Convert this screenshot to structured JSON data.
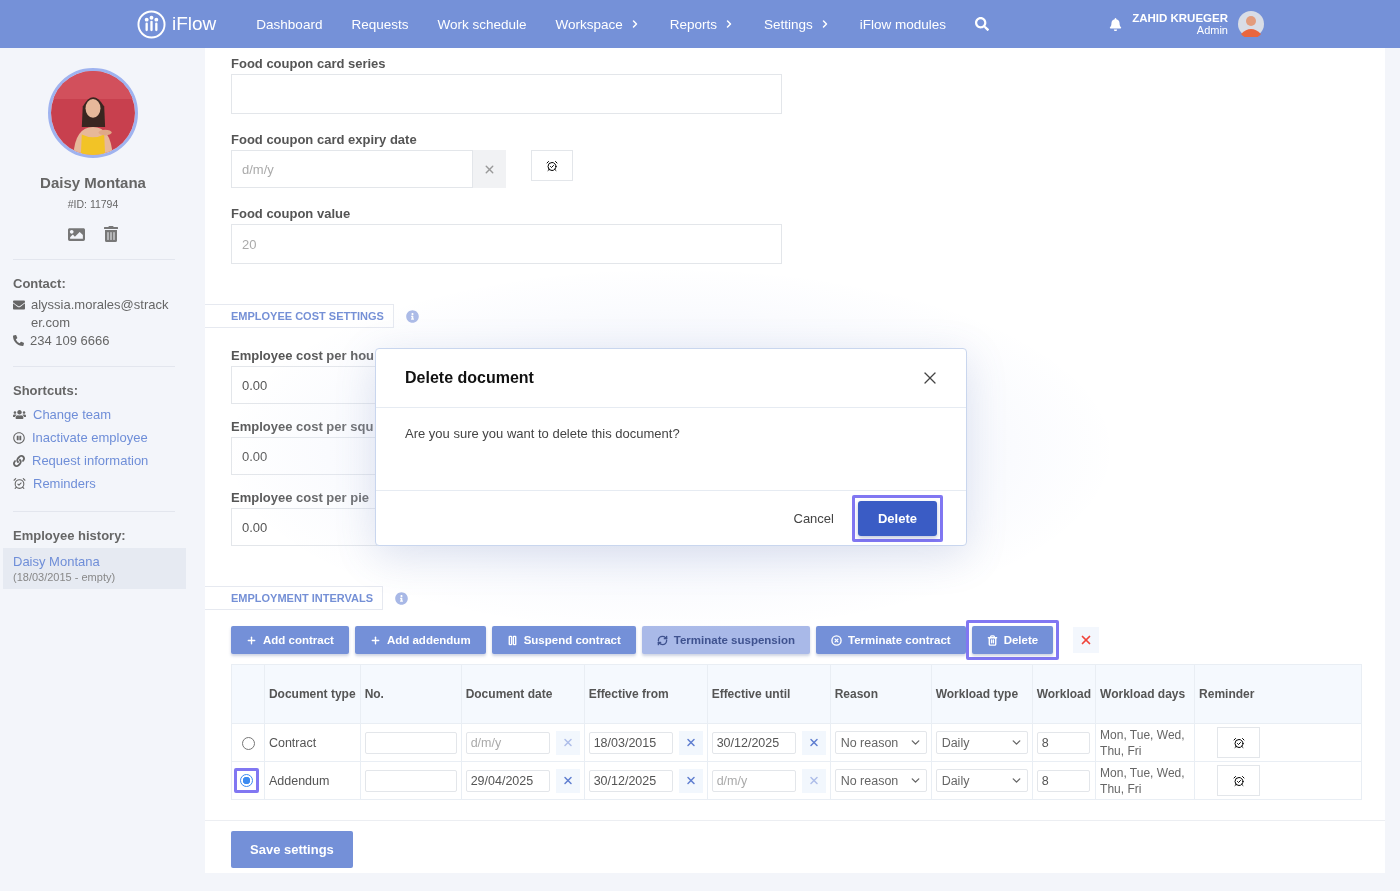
{
  "header": {
    "logo": "iFlow",
    "nav": [
      {
        "label": "Dashboard",
        "has_submenu": false
      },
      {
        "label": "Requests",
        "has_submenu": false
      },
      {
        "label": "Work schedule",
        "has_submenu": false
      },
      {
        "label": "Workspace",
        "has_submenu": true
      },
      {
        "label": "Reports",
        "has_submenu": true
      },
      {
        "label": "Settings",
        "has_submenu": true
      },
      {
        "label": "iFlow modules",
        "has_submenu": false
      }
    ],
    "user": {
      "name": "ZAHID KRUEGER",
      "role": "Admin"
    }
  },
  "sidebar": {
    "profile": {
      "kind": "picture",
      "name": "Daisy Montana",
      "id": "#ID: 11794"
    },
    "contact_title": "Contact:",
    "email": "alyssia.morales@stracker.com",
    "phone": "234 109 6666",
    "shortcuts_title": "Shortcuts:",
    "shortcuts": [
      {
        "label": "Change team",
        "kind": "team"
      },
      {
        "label": "Inactivate employee",
        "kind": "pause"
      },
      {
        "label": "Request information",
        "kind": "link"
      },
      {
        "label": "Reminders",
        "kind": "alarm"
      }
    ],
    "history_title": "Employee history:",
    "history": [
      {
        "name": "Daisy Montana",
        "range": "(18/03/2015 - empty)",
        "selected": true
      }
    ]
  },
  "form": {
    "fields": [
      {
        "label": "Food coupon card series",
        "kind": "text"
      },
      {
        "label": "Food coupon card expiry date",
        "kind": "date",
        "placeholder": "d/m/y"
      },
      {
        "label": "Food coupon value",
        "kind": "text",
        "placeholder": "20"
      }
    ]
  },
  "cost_settings": {
    "title": "EMPLOYEE COST SETTINGS",
    "fields": [
      {
        "label": "Employee cost per hou",
        "value": "0.00"
      },
      {
        "label": "Employee cost per squ",
        "value": "0.00"
      },
      {
        "label": "Employee cost per pie",
        "value": "0.00"
      }
    ]
  },
  "intervals": {
    "title": "EMPLOYMENT INTERVALS",
    "toolbar": [
      {
        "label": "Add contract",
        "kind": "add",
        "disabled": false,
        "highlighted": false
      },
      {
        "label": "Add addendum",
        "kind": "add",
        "disabled": false,
        "highlighted": false
      },
      {
        "label": "Suspend contract",
        "kind": "pause",
        "disabled": false,
        "highlighted": false
      },
      {
        "label": "Terminate suspension",
        "kind": "refresh",
        "disabled": true,
        "highlighted": false
      },
      {
        "label": "Terminate contract",
        "kind": "cancel",
        "disabled": false,
        "highlighted": false
      },
      {
        "label": "Delete",
        "kind": "delete",
        "disabled": false,
        "highlighted": true
      }
    ],
    "table": {
      "columns": [
        "Document type",
        "No.",
        "Document date",
        "Effective from",
        "Effective until",
        "Reason",
        "Workload type",
        "Workload",
        "Workload days",
        "Reminder"
      ],
      "rows": [
        {
          "selected": false,
          "highlighted": false,
          "document_type": "Contract",
          "document_date": {
            "placeholder": "d/m/y"
          },
          "effective_from": {
            "value": "18/03/2015"
          },
          "effective_until": {
            "value": "30/12/2025"
          },
          "reason": "No reason",
          "workload_type": "Daily",
          "workload": "8",
          "workload_days": "Mon, Tue, Wed, Thu, Fri"
        },
        {
          "selected": true,
          "highlighted": true,
          "document_type": "Addendum",
          "document_date": {
            "value": "29/04/2025"
          },
          "effective_from": {
            "value": "30/12/2025"
          },
          "effective_until": {
            "placeholder": "d/m/y"
          },
          "reason": "No reason",
          "workload_type": "Daily",
          "workload": "8",
          "workload_days": "Mon, Tue, Wed, Thu, Fri"
        }
      ]
    }
  },
  "save_button": "Save settings",
  "modal": {
    "title": "Delete document",
    "message": "Are you sure you want to delete this document?",
    "buttons": [
      {
        "label": "Cancel",
        "kind": "secondary",
        "highlighted": false
      },
      {
        "label": "Delete",
        "kind": "primary",
        "highlighted": true
      }
    ]
  }
}
